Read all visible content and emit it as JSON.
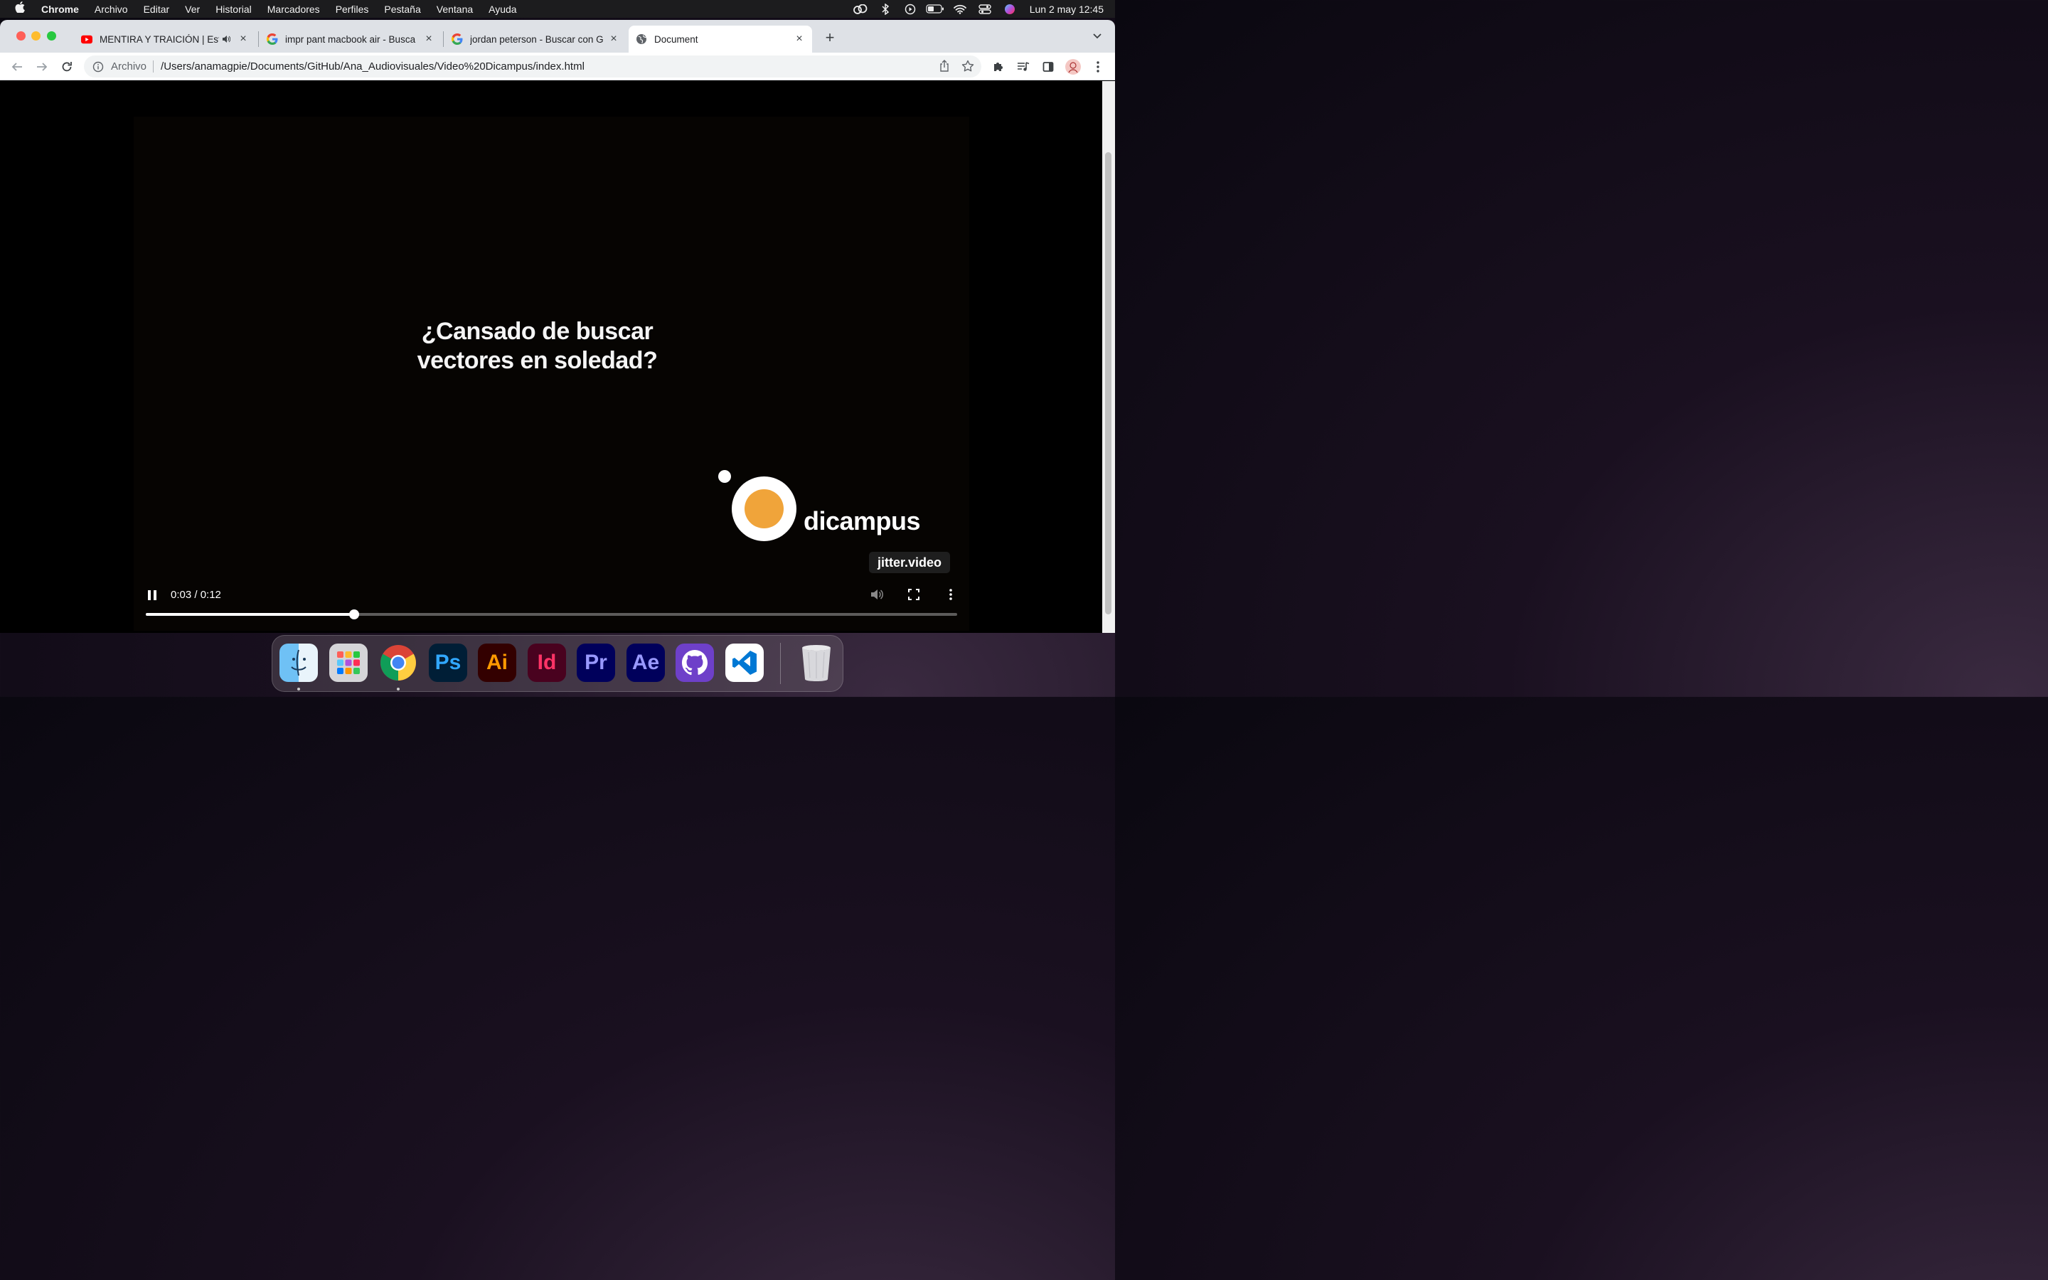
{
  "menubar": {
    "app": "Chrome",
    "items": [
      "Archivo",
      "Editar",
      "Ver",
      "Historial",
      "Marcadores",
      "Perfiles",
      "Pestaña",
      "Ventana",
      "Ayuda"
    ],
    "clock": "Lun 2 may  12:45",
    "status_icons": [
      "creative-cloud-icon",
      "bluetooth-icon",
      "play-circle-icon",
      "battery-icon",
      "wifi-icon",
      "control-center-icon",
      "siri-icon"
    ]
  },
  "tabs": [
    {
      "title": "MENTIRA Y TRAICIÓN | Est",
      "favicon": "youtube-icon",
      "muted_icon": "speaker-icon",
      "close": "×"
    },
    {
      "title": "impr pant macbook air - Busca",
      "favicon": "google-icon",
      "close": "×"
    },
    {
      "title": "jordan peterson - Buscar con G",
      "favicon": "google-icon",
      "close": "×"
    },
    {
      "title": "Document",
      "favicon": "globe-icon",
      "close": "×",
      "active": true
    }
  ],
  "new_tab_label": "+",
  "address": {
    "scheme": "Archivo",
    "url": "/Users/anamagpie/Documents/GitHub/Ana_Audiovisuales/Video%20Dicampus/index.html"
  },
  "video": {
    "caption_line1": "¿Cansado de buscar",
    "caption_line2": "vectores en soledad?",
    "logo_text": "dicampus",
    "watermark": "jitter.video",
    "time": "0:03 / 0:12",
    "progress": 0.257,
    "accent_color": "#f0a43a"
  },
  "dock": {
    "apps": [
      {
        "name": "Finder",
        "label": ""
      },
      {
        "name": "Launchpad",
        "label": ""
      },
      {
        "name": "Chrome",
        "label": ""
      },
      {
        "name": "Photoshop",
        "label": "Ps"
      },
      {
        "name": "Illustrator",
        "label": "Ai"
      },
      {
        "name": "InDesign",
        "label": "Id"
      },
      {
        "name": "Premiere Pro",
        "label": "Pr"
      },
      {
        "name": "After Effects",
        "label": "Ae"
      },
      {
        "name": "GitHub Desktop",
        "label": ""
      },
      {
        "name": "Visual Studio Code",
        "label": ""
      },
      {
        "name": "Trash",
        "label": ""
      }
    ]
  }
}
